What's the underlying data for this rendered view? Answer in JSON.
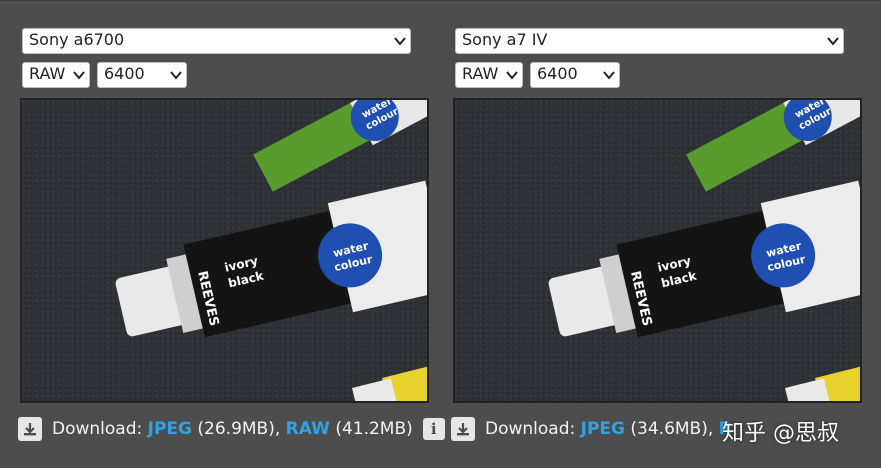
{
  "left": {
    "camera": "Sony a6700",
    "format": "RAW",
    "iso": "6400",
    "download": {
      "prefix": "Download:",
      "jpeg_label": "JPEG",
      "jpeg_size": "(26.9MB),",
      "raw_label": "RAW",
      "raw_size": "(41.2MB)"
    },
    "photo": {
      "tube_small_label_1": "water",
      "tube_small_label_2": "colour",
      "tube_brand": "REEVES",
      "tube_color_1": "ivory",
      "tube_color_2": "black",
      "tube_blue_1": "water",
      "tube_blue_2": "colour"
    }
  },
  "right": {
    "camera": "Sony a7 IV",
    "format": "RAW",
    "iso": "6400",
    "download": {
      "prefix": "Download:",
      "jpeg_label": "JPEG",
      "jpeg_size": "(34.6MB),",
      "raw_label": "R",
      "raw_size": "..."
    },
    "photo": {
      "tube_small_label_1": "water",
      "tube_small_label_2": "colour",
      "tube_brand": "REEVES",
      "tube_color_1": "ivory",
      "tube_color_2": "black",
      "tube_blue_1": "water",
      "tube_blue_2": "colour"
    }
  },
  "info_icon": "i",
  "watermark": "知乎 @思叔",
  "colors": {
    "background": "#4d4d4d",
    "link": "#2ea3e6",
    "tube_blue": "#1f4fb0"
  }
}
